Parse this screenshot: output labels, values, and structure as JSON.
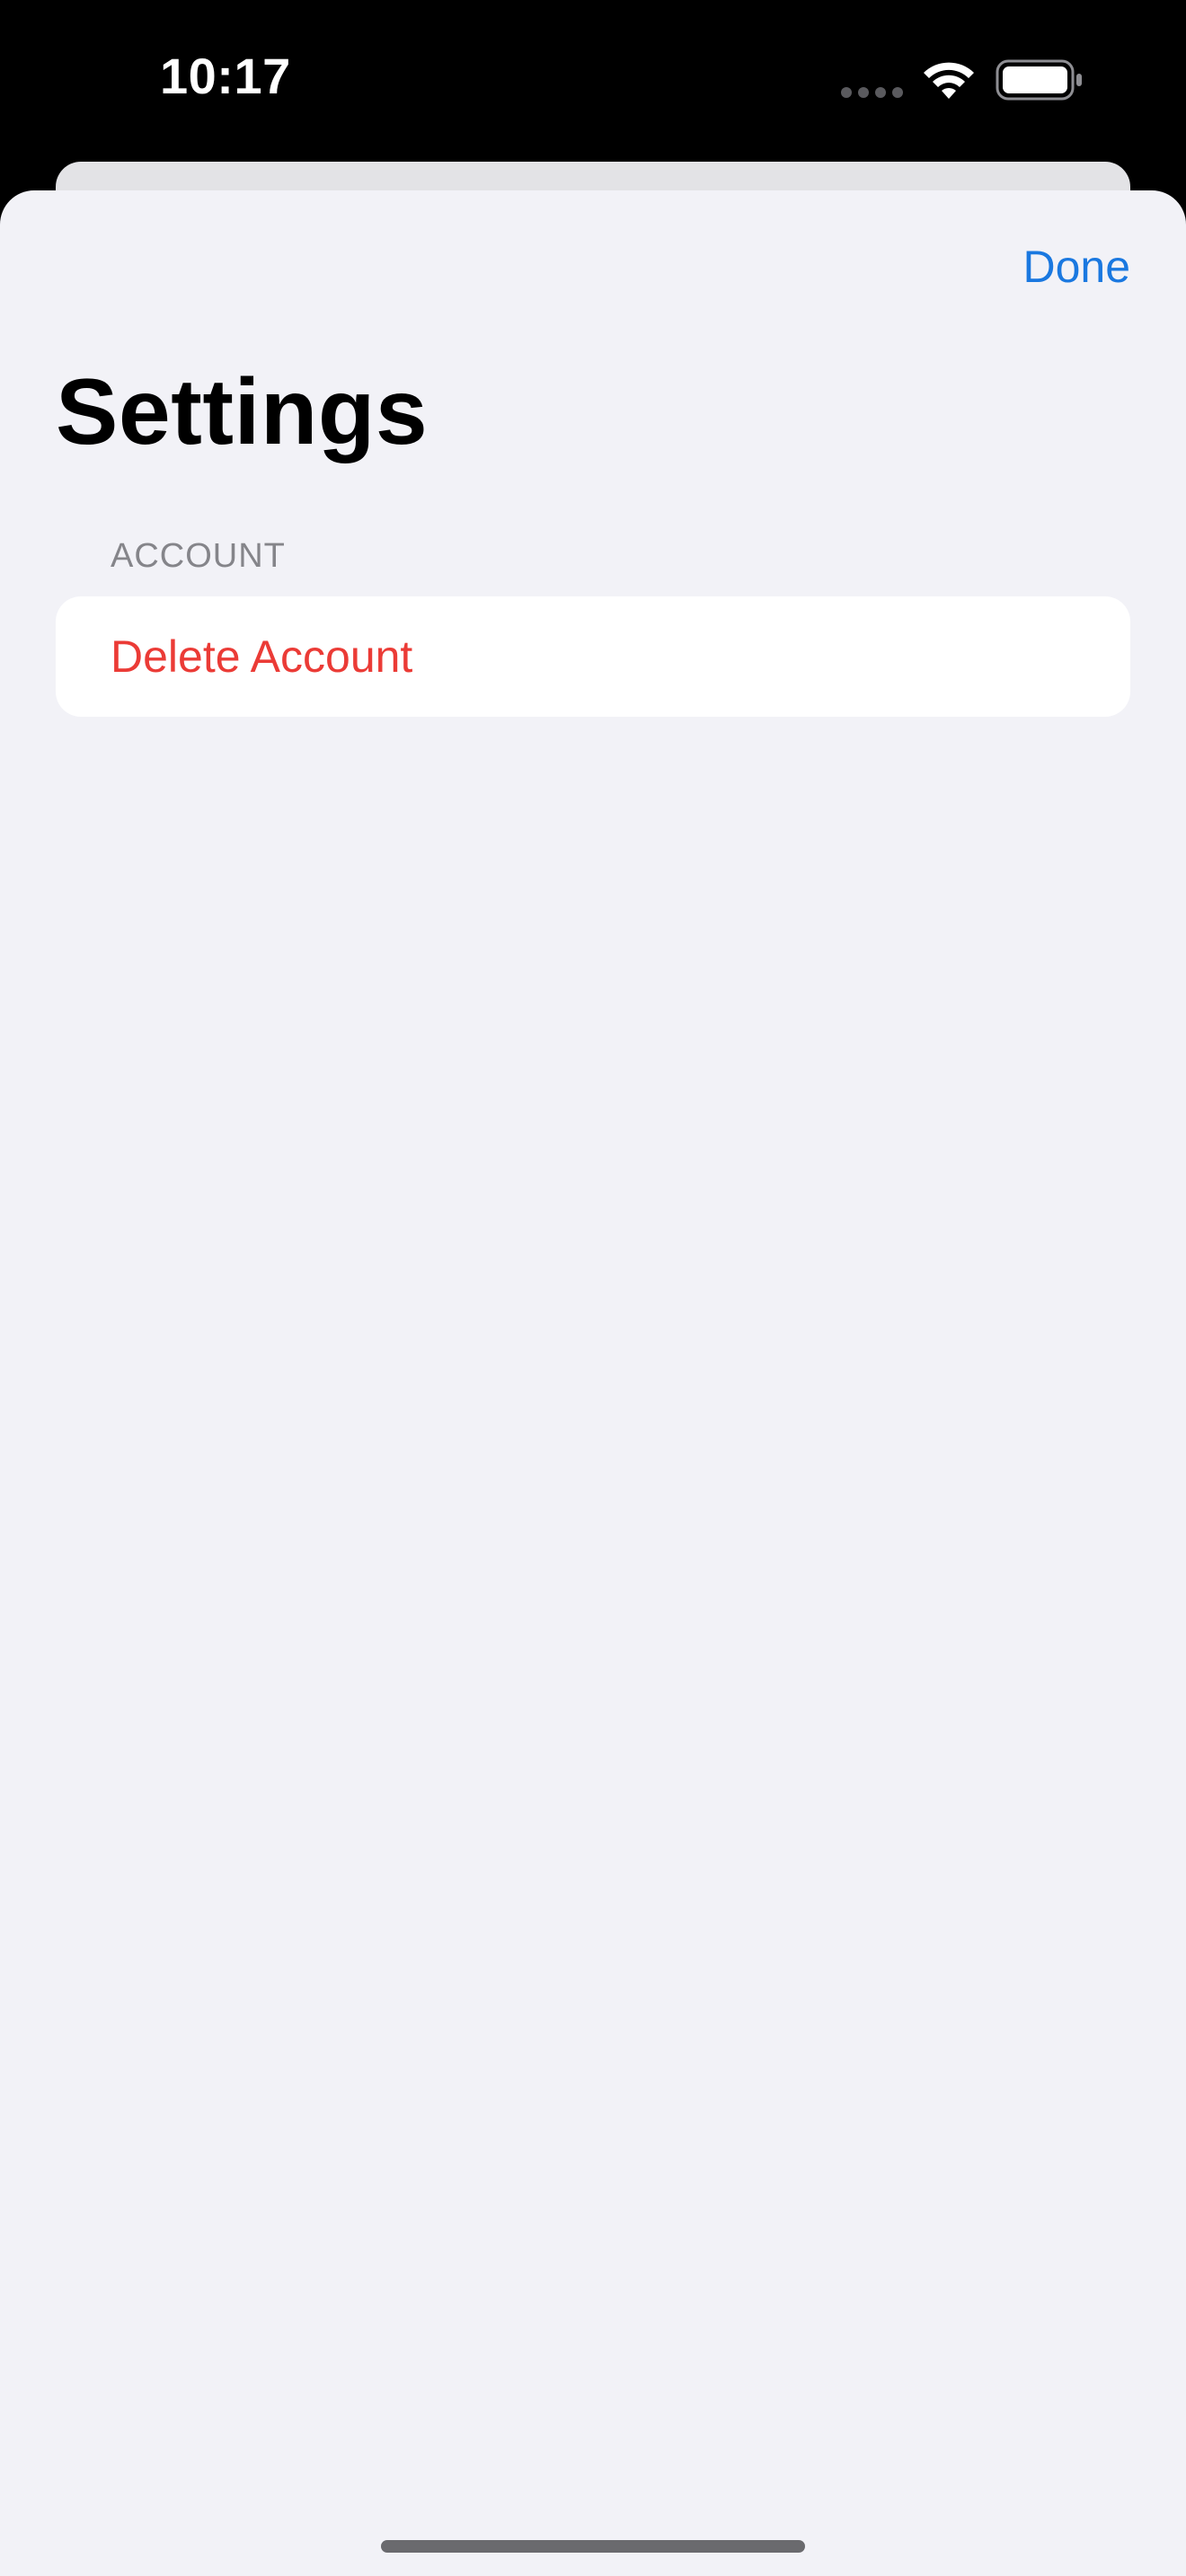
{
  "status_bar": {
    "time": "10:17",
    "icons": [
      "cellular-signal-icon",
      "wifi-icon",
      "battery-icon"
    ]
  },
  "sheet": {
    "done_label": "Done",
    "title": "Settings",
    "sections": [
      {
        "header": "ACCOUNT",
        "rows": [
          {
            "label": "Delete Account",
            "style": "destructive"
          }
        ]
      }
    ]
  },
  "colors": {
    "accent": "#1a78e0",
    "destructive": "#eb3b36",
    "sheet_background": "#f2f2f7",
    "section_header": "#85858a"
  }
}
